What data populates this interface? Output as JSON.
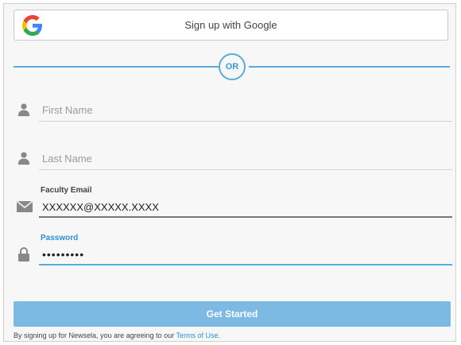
{
  "google_button": {
    "label": "Sign up with Google",
    "icon": "google-g-icon"
  },
  "divider": {
    "label": "OR",
    "color": "#5aa9d9"
  },
  "fields": {
    "first_name": {
      "placeholder": "First Name",
      "icon": "person-icon"
    },
    "last_name": {
      "placeholder": "Last Name",
      "icon": "person-icon"
    },
    "email": {
      "label": "Faculty Email",
      "value": "XXXXXX@XXXXX.XXXX",
      "icon": "envelope-icon"
    },
    "password": {
      "label": "Password",
      "value": "•••••••••",
      "icon": "lock-icon"
    }
  },
  "cta": {
    "label": "Get Started",
    "color": "#7cb9e3"
  },
  "legal": {
    "prefix": "By signing up for Newsela, you are agreeing to our",
    "link": "Terms of Use",
    "suffix": "."
  }
}
